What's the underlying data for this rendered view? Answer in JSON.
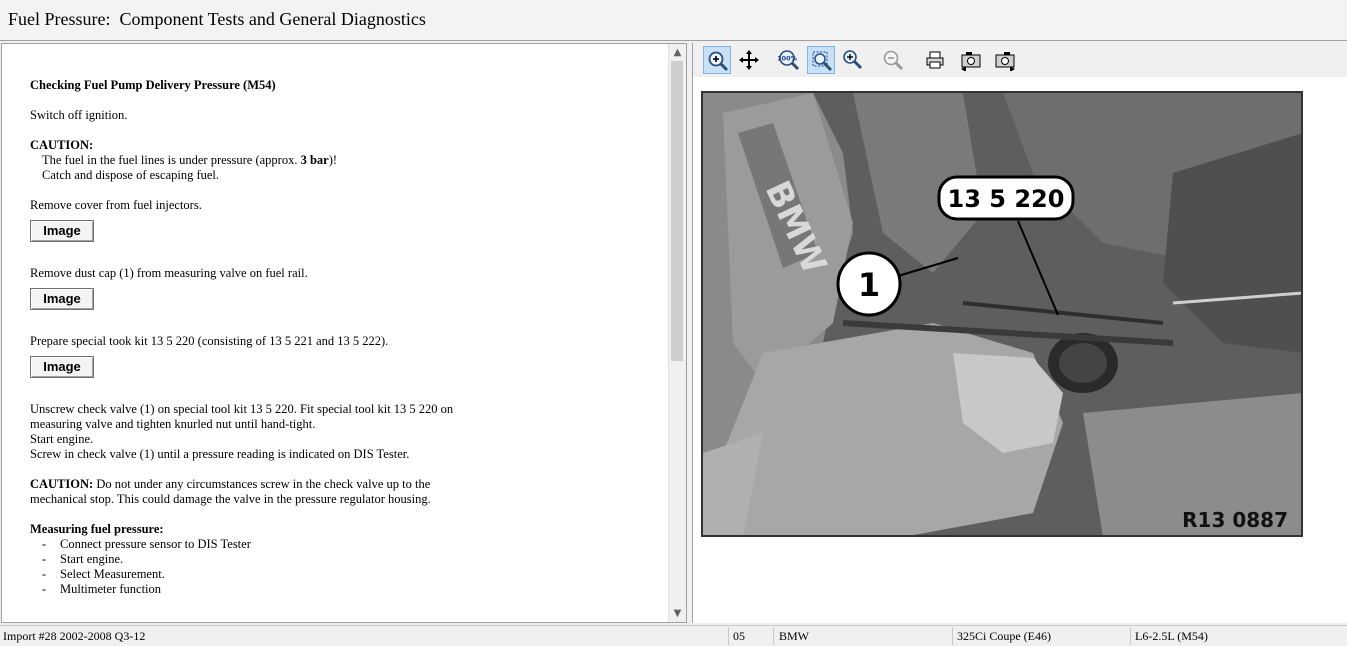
{
  "window": {
    "title": "Fuel Pressure:  Component Tests and General Diagnostics"
  },
  "document": {
    "heading": "Checking Fuel Pump Delivery Pressure (M54)",
    "step_switch_off": "Switch off ignition.",
    "caution_label": "CAUTION:",
    "caution_line1_pre": "The fuel in the fuel lines is under pressure (approx. ",
    "caution_line1_bold": "3 bar",
    "caution_line1_post": ")!",
    "caution_line2": "Catch and dispose of escaping fuel.",
    "step_remove_cover": "Remove cover from fuel injectors.",
    "image_button_label": "Image",
    "step_remove_dust_cap": "Remove dust cap (1) from measuring valve on fuel rail.",
    "step_prepare_kit": "Prepare special took kit 13 5 220 (consisting of 13 5 221 and 13 5 222).",
    "step_unscrew_1": "Unscrew check valve (1) on special tool kit 13 5 220. Fit special tool kit 13 5 220 on",
    "step_unscrew_2": "measuring valve and tighten knurled nut until hand-tight.",
    "step_start_engine": "Start engine.",
    "step_screw_in": "Screw in check valve (1) until a pressure reading is indicated on DIS Tester.",
    "caution2_label": "CAUTION:",
    "caution2_text_1": "  Do not under any circumstances screw in the check valve up to the",
    "caution2_text_2": "mechanical stop. This could damage the valve in the pressure regulator housing.",
    "measuring_heading": "Measuring fuel pressure:",
    "measuring_items": [
      "Connect pressure sensor to DIS Tester",
      "Start engine.",
      "Select Measurement.",
      "Multimeter function"
    ],
    "bullet_dash": "-"
  },
  "scroll": {
    "up_glyph": "▲",
    "down_glyph": "▼"
  },
  "toolbar": {
    "buttons": [
      "zoom-in-tool",
      "pan-tool",
      "actual-size-tool",
      "fit-window-tool",
      "zoom-in-small-tool",
      "zoom-out-tool",
      "print-tool",
      "previous-image-tool",
      "next-image-tool"
    ],
    "actual_size_text": "100%"
  },
  "photo": {
    "callout_tool": "13 5 220",
    "callout_part": "1",
    "brand_text": "BMW",
    "reference_code": "R13 0887"
  },
  "status": {
    "import": "Import #28 2002-2008 Q3-12",
    "code": "05",
    "make": "BMW",
    "model": "325Ci Coupe (E46)",
    "engine": "L6-2.5L (M54)"
  }
}
